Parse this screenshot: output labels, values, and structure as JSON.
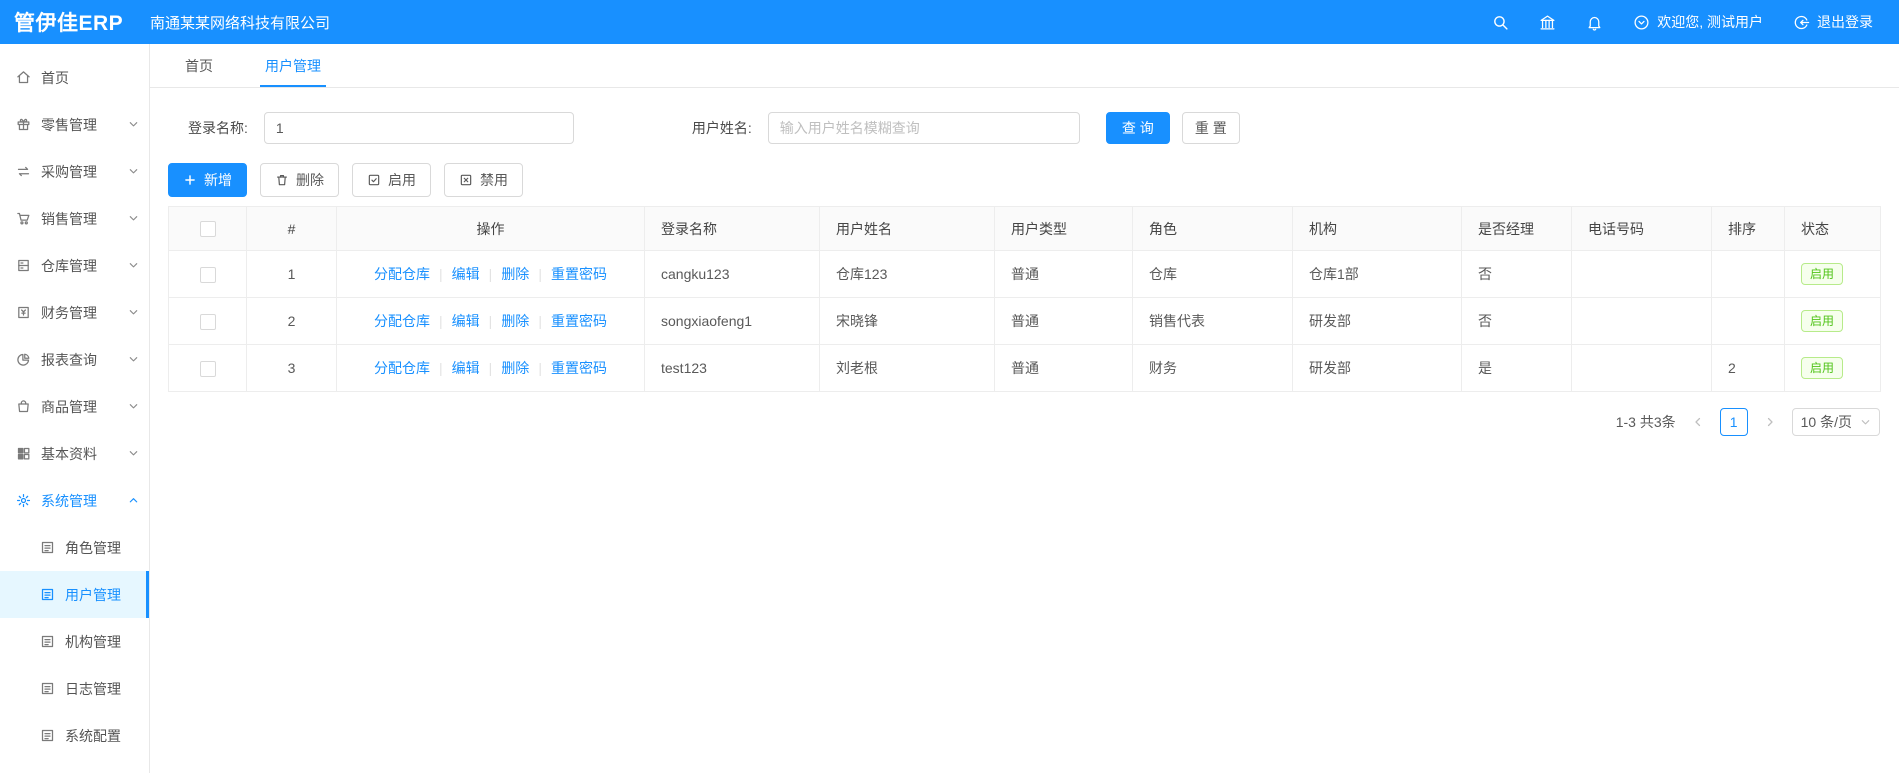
{
  "colors": {
    "primary": "#1890ff",
    "status_green": "#52c41a",
    "sidebar_active_bg": "#e6f7ff"
  },
  "header": {
    "logo": "管伊佳ERP",
    "company": "南通某某网络科技有限公司",
    "welcome": "欢迎您, 测试用户",
    "logout": "退出登录"
  },
  "sidebar": {
    "items": [
      {
        "label": "首页",
        "icon": "home-icon"
      },
      {
        "label": "零售管理",
        "icon": "gift-icon"
      },
      {
        "label": "采购管理",
        "icon": "swap-icon"
      },
      {
        "label": "销售管理",
        "icon": "cart-icon"
      },
      {
        "label": "仓库管理",
        "icon": "warehouse-icon"
      },
      {
        "label": "财务管理",
        "icon": "finance-icon"
      },
      {
        "label": "报表查询",
        "icon": "pie-chart-icon"
      },
      {
        "label": "商品管理",
        "icon": "bag-icon"
      },
      {
        "label": "基本资料",
        "icon": "grid-icon"
      },
      {
        "label": "系统管理",
        "icon": "gear-icon"
      }
    ],
    "system_sub": [
      {
        "label": "角色管理"
      },
      {
        "label": "用户管理"
      },
      {
        "label": "机构管理"
      },
      {
        "label": "日志管理"
      },
      {
        "label": "系统配置"
      }
    ]
  },
  "tabs": [
    {
      "label": "首页"
    },
    {
      "label": "用户管理"
    }
  ],
  "search": {
    "login_label": "登录名称:",
    "login_value": "1",
    "name_label": "用户姓名:",
    "name_placeholder": "输入用户姓名模糊查询",
    "query_label": "查 询",
    "reset_label": "重 置"
  },
  "toolbar": {
    "add_label": "新增",
    "delete_label": "删除",
    "enable_label": "启用",
    "disable_label": "禁用"
  },
  "table": {
    "headers": {
      "index": "#",
      "actions": "操作",
      "login": "登录名称",
      "name": "用户姓名",
      "type": "用户类型",
      "role": "角色",
      "org": "机构",
      "manager": "是否经理",
      "phone": "电话号码",
      "sort": "排序",
      "status": "状态"
    },
    "row_actions": [
      "分配仓库",
      "编辑",
      "删除",
      "重置密码"
    ],
    "rows": [
      {
        "index": "1",
        "login": "cangku123",
        "name": "仓库123",
        "type": "普通",
        "role": "仓库",
        "org": "仓库1部",
        "manager": "否",
        "phone": "",
        "sort": "",
        "status": "启用"
      },
      {
        "index": "2",
        "login": "songxiaofeng1",
        "name": "宋晓锋",
        "type": "普通",
        "role": "销售代表",
        "org": "研发部",
        "manager": "否",
        "phone": "",
        "sort": "",
        "status": "启用"
      },
      {
        "index": "3",
        "login": "test123",
        "name": "刘老根",
        "type": "普通",
        "role": "财务",
        "org": "研发部",
        "manager": "是",
        "phone": "",
        "sort": "2",
        "status": "启用"
      }
    ]
  },
  "pagination": {
    "total_text": "1-3 共3条",
    "current_page": "1",
    "page_size": "10 条/页"
  }
}
